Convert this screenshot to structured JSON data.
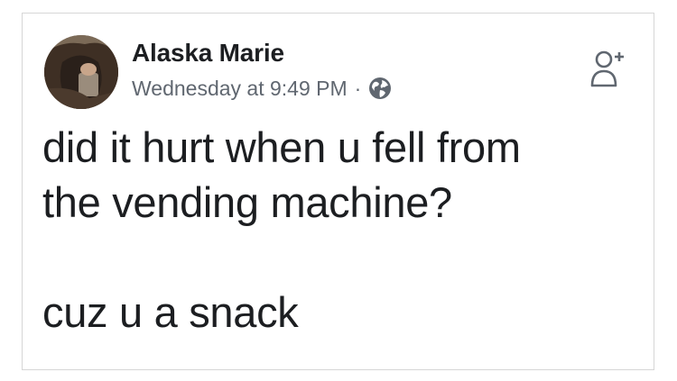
{
  "post": {
    "author_name": "Alaska Marie",
    "timestamp": "Wednesday at 9:49 PM",
    "separator": "·",
    "audience_icon": "globe-icon",
    "action_icon": "add-friend-icon",
    "text_lines": [
      "did it hurt when u fell from",
      "the vending machine?",
      "cuz u a snack"
    ]
  },
  "colors": {
    "primary_text": "#1c1e21",
    "secondary_text": "#606770",
    "border": "#d6d6d6"
  }
}
